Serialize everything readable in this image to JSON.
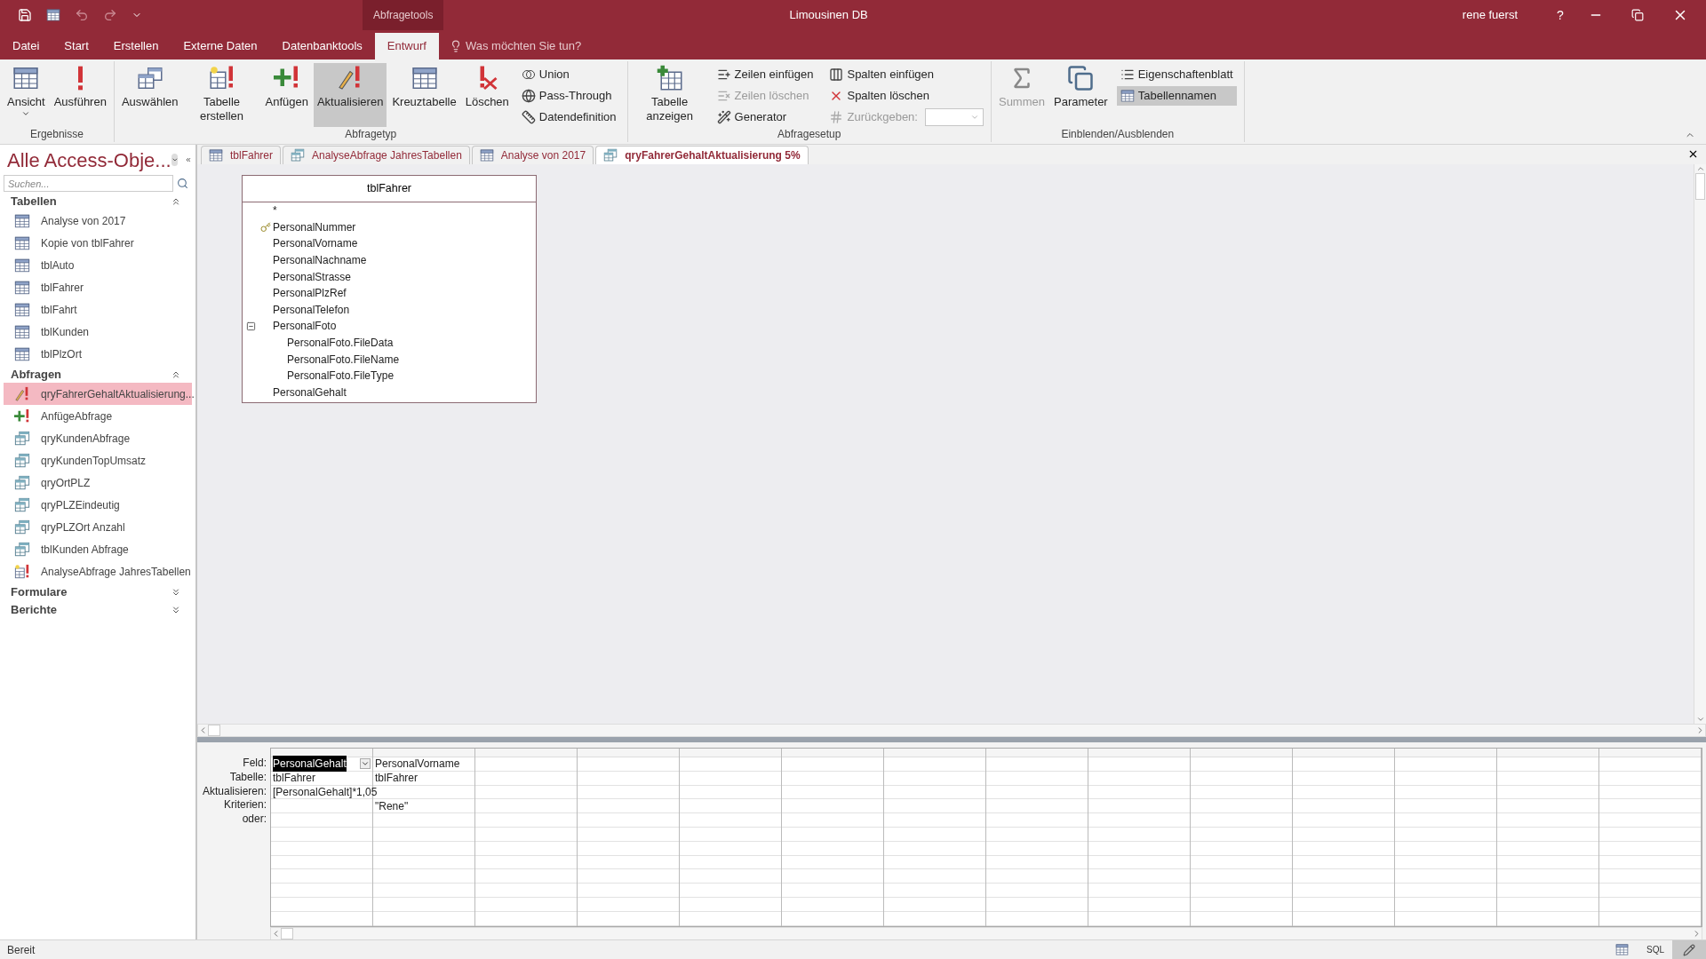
{
  "title_bar": {
    "context_tab": "Abfragetools",
    "title": "Limousinen DB",
    "user": "rene fuerst",
    "help": "?"
  },
  "menu_tabs": [
    {
      "label": "Datei",
      "selected": false
    },
    {
      "label": "Start",
      "selected": false
    },
    {
      "label": "Erstellen",
      "selected": false
    },
    {
      "label": "Externe Daten",
      "selected": false
    },
    {
      "label": "Datenbanktools",
      "selected": false
    },
    {
      "label": "Entwurf",
      "selected": true
    }
  ],
  "tell_me": "Was möchten Sie tun?",
  "ribbon": {
    "groups": [
      {
        "label": "Ergebnisse",
        "items": [
          {
            "label": "Ansicht",
            "kind": "large_menu",
            "selected": false,
            "disabled": false
          },
          {
            "label": "Ausführen",
            "kind": "large",
            "selected": false,
            "disabled": false
          }
        ]
      },
      {
        "label": "Abfragetyp",
        "items": [
          {
            "label": "Auswählen",
            "kind": "large",
            "selected": false,
            "disabled": false
          },
          {
            "label": "Tabelle erstellen",
            "kind": "large",
            "selected": false,
            "disabled": false
          },
          {
            "label": "Anfügen",
            "kind": "large",
            "selected": false,
            "disabled": false
          },
          {
            "label": "Aktualisieren",
            "kind": "large",
            "selected": true,
            "disabled": false
          },
          {
            "label": "Kreuztabelle",
            "kind": "large",
            "selected": false,
            "disabled": false
          },
          {
            "label": "Löschen",
            "kind": "large",
            "selected": false,
            "disabled": false
          },
          {
            "label": "Union",
            "kind": "small",
            "selected": false,
            "disabled": false
          },
          {
            "label": "Pass-Through",
            "kind": "small",
            "selected": false,
            "disabled": false
          },
          {
            "label": "Datendefinition",
            "kind": "small",
            "selected": false,
            "disabled": false
          }
        ]
      },
      {
        "label": "Abfragesetup",
        "items": [
          {
            "label": "Tabelle anzeigen",
            "kind": "large",
            "selected": false,
            "disabled": false
          },
          {
            "label": "Zeilen einfügen",
            "kind": "small",
            "selected": false,
            "disabled": false
          },
          {
            "label": "Zeilen löschen",
            "kind": "small",
            "selected": false,
            "disabled": true
          },
          {
            "label": "Generator",
            "kind": "small",
            "selected": false,
            "disabled": false
          },
          {
            "label": "Spalten einfügen",
            "kind": "small",
            "selected": false,
            "disabled": false
          },
          {
            "label": "Spalten löschen",
            "kind": "small",
            "selected": false,
            "disabled": false
          },
          {
            "label": "Zurückgeben:",
            "kind": "combo",
            "selected": false,
            "disabled": true
          }
        ]
      },
      {
        "label": "Einblenden/Ausblenden",
        "items": [
          {
            "label": "Summen",
            "kind": "large",
            "selected": false,
            "disabled": true
          },
          {
            "label": "Parameter",
            "kind": "large",
            "selected": false,
            "disabled": false
          },
          {
            "label": "Eigenschaftenblatt",
            "kind": "small",
            "selected": false,
            "disabled": false
          },
          {
            "label": "Tabellennamen",
            "kind": "small",
            "selected": true,
            "disabled": false
          }
        ]
      }
    ]
  },
  "nav_pane": {
    "title": "Alle Access-Obje...",
    "search": {
      "placeholder": "Suchen..."
    },
    "groups": [
      {
        "label": "Tabellen",
        "expanded": true,
        "items": [
          {
            "label": "Analyse von 2017",
            "kind": "table",
            "selected": false
          },
          {
            "label": "Kopie von tblFahrer",
            "kind": "table",
            "selected": false
          },
          {
            "label": "tblAuto",
            "kind": "table",
            "selected": false
          },
          {
            "label": "tblFahrer",
            "kind": "table",
            "selected": false
          },
          {
            "label": "tblFahrt",
            "kind": "table",
            "selected": false
          },
          {
            "label": "tblKunden",
            "kind": "table",
            "selected": false
          },
          {
            "label": "tblPlzOrt",
            "kind": "table",
            "selected": false
          }
        ]
      },
      {
        "label": "Abfragen",
        "expanded": true,
        "items": [
          {
            "label": "qryFahrerGehaltAktualisierung...",
            "kind": "update_query",
            "selected": true
          },
          {
            "label": "AnfügeAbfrage",
            "kind": "append_query",
            "selected": false
          },
          {
            "label": "qryKundenAbfrage",
            "kind": "select_query",
            "selected": false
          },
          {
            "label": "qryKundenTopUmsatz",
            "kind": "select_query",
            "selected": false
          },
          {
            "label": "qryOrtPLZ",
            "kind": "select_query",
            "selected": false
          },
          {
            "label": "qryPLZEindeutig",
            "kind": "select_query",
            "selected": false
          },
          {
            "label": "qryPLZOrt Anzahl",
            "kind": "select_query",
            "selected": false
          },
          {
            "label": "tblKunden Abfrage",
            "kind": "select_query",
            "selected": false
          },
          {
            "label": "AnalyseAbfrage JahresTabellen",
            "kind": "maketable_query",
            "selected": false
          }
        ]
      },
      {
        "label": "Formulare",
        "expanded": false
      },
      {
        "label": "Berichte",
        "expanded": false
      }
    ]
  },
  "doc_tabs": [
    {
      "label": "tblFahrer",
      "kind": "table",
      "selected": false
    },
    {
      "label": "AnalyseAbfrage JahresTabellen",
      "kind": "query",
      "selected": false
    },
    {
      "label": "Analyse von 2017",
      "kind": "table",
      "selected": false
    },
    {
      "label": "qryFahrerGehaltAktualisierung 5%",
      "kind": "query",
      "selected": true
    }
  ],
  "table_window": {
    "title": "tblFahrer",
    "fields": [
      {
        "name": "*",
        "primary_key": false
      },
      {
        "name": "PersonalNummer",
        "primary_key": true
      },
      {
        "name": "PersonalVorname",
        "primary_key": false
      },
      {
        "name": "PersonalNachname",
        "primary_key": false
      },
      {
        "name": "PersonalStrasse",
        "primary_key": false
      },
      {
        "name": "PersonalPlzRef",
        "primary_key": false
      },
      {
        "name": "PersonalTelefon",
        "primary_key": false
      },
      {
        "name": "PersonalFoto",
        "primary_key": false,
        "expanded": true,
        "children": [
          {
            "name": "PersonalFoto.FileData"
          },
          {
            "name": "PersonalFoto.FileName"
          },
          {
            "name": "PersonalFoto.FileType"
          }
        ]
      },
      {
        "name": "PersonalGehalt",
        "primary_key": false
      }
    ]
  },
  "query_grid": {
    "row_labels": [
      "Feld:",
      "Tabelle:",
      "Aktualisieren:",
      "Kriterien:",
      "oder:"
    ],
    "columns": [
      {
        "field": "PersonalGehalt",
        "table": "tblFahrer",
        "update": "[PersonalGehalt]*1,05",
        "selected": true
      },
      {
        "field": "PersonalVorname",
        "table": "tblFahrer",
        "criteria": "\"Rene\"",
        "selected": false
      }
    ]
  },
  "status_bar": {
    "text": "Bereit",
    "views": [
      {
        "kind": "datasheet",
        "selected": false
      },
      {
        "kind": "sql",
        "label": "SQL",
        "selected": false
      },
      {
        "kind": "design",
        "selected": true
      }
    ]
  }
}
